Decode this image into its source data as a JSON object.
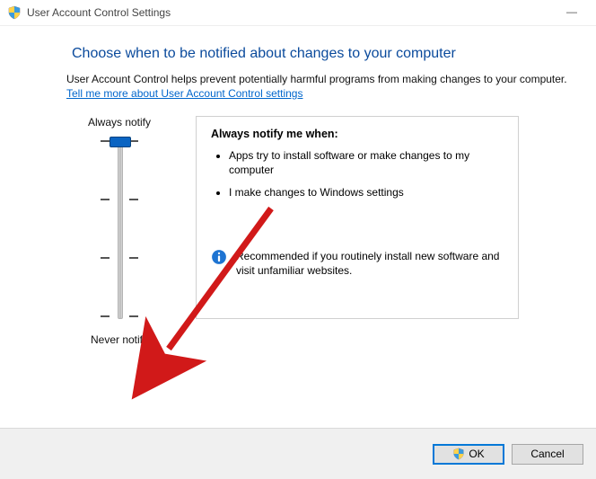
{
  "window": {
    "title": "User Account Control Settings"
  },
  "heading": "Choose when to be notified about changes to your computer",
  "description": "User Account Control helps prevent potentially harmful programs from making changes to your computer.",
  "help_link": "Tell me more about User Account Control settings",
  "slider": {
    "top_label": "Always notify",
    "bottom_label": "Never notify",
    "levels": 4,
    "value": 3
  },
  "panel": {
    "title": "Always notify me when:",
    "bullets": [
      "Apps try to install software or make changes to my computer",
      "I make changes to Windows settings"
    ],
    "recommend": "Recommended if you routinely install new software and visit unfamiliar websites."
  },
  "buttons": {
    "ok": "OK",
    "cancel": "Cancel"
  }
}
